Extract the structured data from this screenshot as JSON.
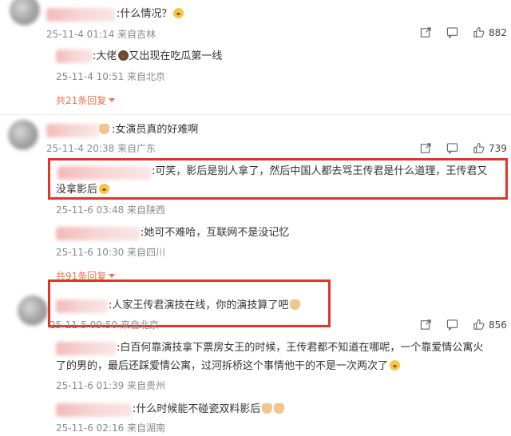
{
  "comments": [
    {
      "text": ":什么情况？",
      "meta": "25-11-4 01:14 来自吉林",
      "likes": "882",
      "replies": [
        {
          "text": ":大佬",
          "text_after": "又出现在吃瓜第一线",
          "meta": "25-11-4 10:51 来自北京"
        }
      ],
      "more": "共21条回复"
    },
    {
      "text": ":女演员真的好难啊",
      "meta": "25-11-4 20:38 来自广东",
      "likes": "739",
      "replies": [
        {
          "text_line1": ":可笑，影后是别人拿了，然后中国人都去骂王传君是什么道理，王传君又",
          "text_line2": "没拿影后",
          "meta": "25-11-6 03:48 来自陕西"
        },
        {
          "text": ":她可不难哈，互联网不是没记忆",
          "meta": "25-11-6 10:30 来自四川"
        }
      ],
      "more": "共91条回复"
    },
    {
      "text": ":人家王传君演技在线，你的演技算了吧",
      "meta": "25-11-5 09:50 来自北京",
      "likes": "856",
      "replies": [
        {
          "text_line1": ":白百何靠演技拿下票房女王的时候，王传君都不知道在哪呢，一个靠爱情公寓火",
          "text_line2": "了的男的，最后还踩爱情公寓，过河拆桥这个事情他干的不是一次两次了",
          "meta": "25-11-6 01:39 来自贵州"
        },
        {
          "text": ":什么时候能不碰瓷双料影后",
          "meta": "25-11-6 02:16 来自湖南"
        }
      ]
    }
  ],
  "icons": [
    "share-icon",
    "comment-icon",
    "like-icon"
  ],
  "colors": {
    "highlight": "#e0352b",
    "more_link": "#eb7350",
    "meta": "#8a8a8a"
  }
}
